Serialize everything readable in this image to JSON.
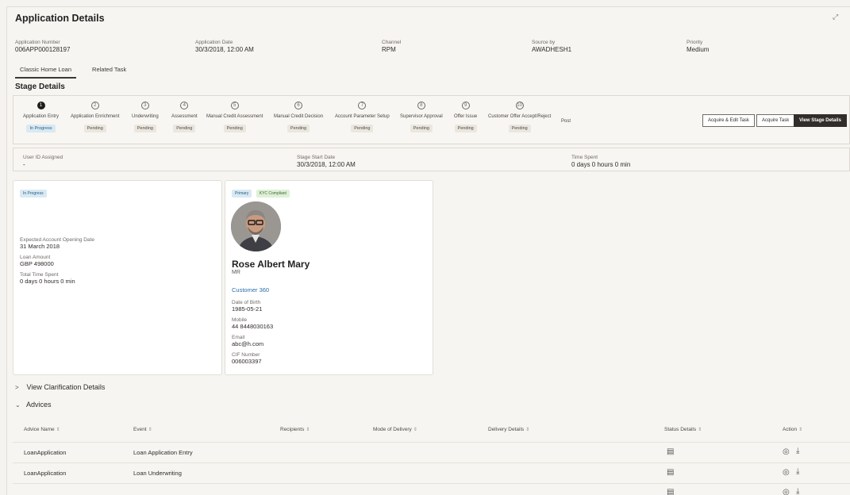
{
  "header": {
    "title": "Application Details"
  },
  "application": {
    "number_label": "Application Number",
    "number": "006APP000128197",
    "date_label": "Application Date",
    "date": "30/3/2018, 12:00 AM",
    "channel_label": "Channel",
    "channel": "RPM",
    "source_label": "Source by",
    "source": "AWADHESH1",
    "priority_label": "Priority",
    "priority": "Medium"
  },
  "tabs": [
    {
      "label": "Classic Home Loan",
      "active": true
    },
    {
      "label": "Related Task",
      "active": false
    }
  ],
  "stage_details": {
    "title": "Stage Details",
    "stages": [
      {
        "num": "1",
        "name": "Application Entry",
        "status": "In Progress"
      },
      {
        "num": "2",
        "name": "Application Enrichment",
        "status": "Pending"
      },
      {
        "num": "3",
        "name": "Underwriting",
        "status": "Pending"
      },
      {
        "num": "4",
        "name": "Assessment",
        "status": "Pending"
      },
      {
        "num": "5",
        "name": "Manual Credit Assessment",
        "status": "Pending"
      },
      {
        "num": "6",
        "name": "Manual Credit Decision",
        "status": "Pending"
      },
      {
        "num": "7",
        "name": "Account Parameter Setup",
        "status": "Pending"
      },
      {
        "num": "8",
        "name": "Supervisor Approval",
        "status": "Pending"
      },
      {
        "num": "9",
        "name": "Offer Issue",
        "status": "Pending"
      },
      {
        "num": "10",
        "name": "Customer Offer Accept/Reject",
        "status": "Pending"
      },
      {
        "num": "",
        "name": "Post",
        "status": ""
      }
    ],
    "buttons": {
      "acquire_edit": "Acquire & Edit Task",
      "acquire": "Acquire Task",
      "view_stage": "View Stage Details"
    }
  },
  "assignment": {
    "user_label": "User ID Assigned",
    "user": "-",
    "start_label": "Stage Start Date",
    "start": "30/3/2018, 12:00 AM",
    "spent_label": "Time Spent",
    "spent": "0 days 0 hours 0 min"
  },
  "summary_card": {
    "status": "In Progress",
    "opening_label": "Expected Account Opening Date",
    "opening": "31 March 2018",
    "amount_label": "Loan Amount",
    "amount": "GBP 498000",
    "total_label": "Total Time Spent",
    "total": "0 days 0 hours 0 min"
  },
  "customer_card": {
    "tag_primary": "Primary",
    "tag_kyc": "KYC Compliant",
    "name": "Rose Albert Mary",
    "salutation": "MR",
    "link": "Customer 360",
    "dob_label": "Date of Birth",
    "dob": "1985-05-21",
    "mobile_label": "Mobile",
    "mobile": "44 8448030163",
    "email_label": "Email",
    "email": "abc@h.com",
    "cif_label": "CIF Number",
    "cif": "006003397"
  },
  "sections": {
    "clarification": "View Clarification Details",
    "advices": "Advices"
  },
  "advices_table": {
    "columns": [
      "Advice Name",
      "Event",
      "Recipients",
      "Mode of Delivery",
      "Delivery Details",
      "Status Details",
      "Action"
    ],
    "rows": [
      {
        "name": "LoanApplication",
        "event": "Loan Application Entry"
      },
      {
        "name": "LoanApplication",
        "event": "Loan Underwriting"
      }
    ]
  },
  "colors": {
    "accent_dark": "#312d2a",
    "in_progress": "#1f5d86",
    "link": "#2b6fa8"
  }
}
